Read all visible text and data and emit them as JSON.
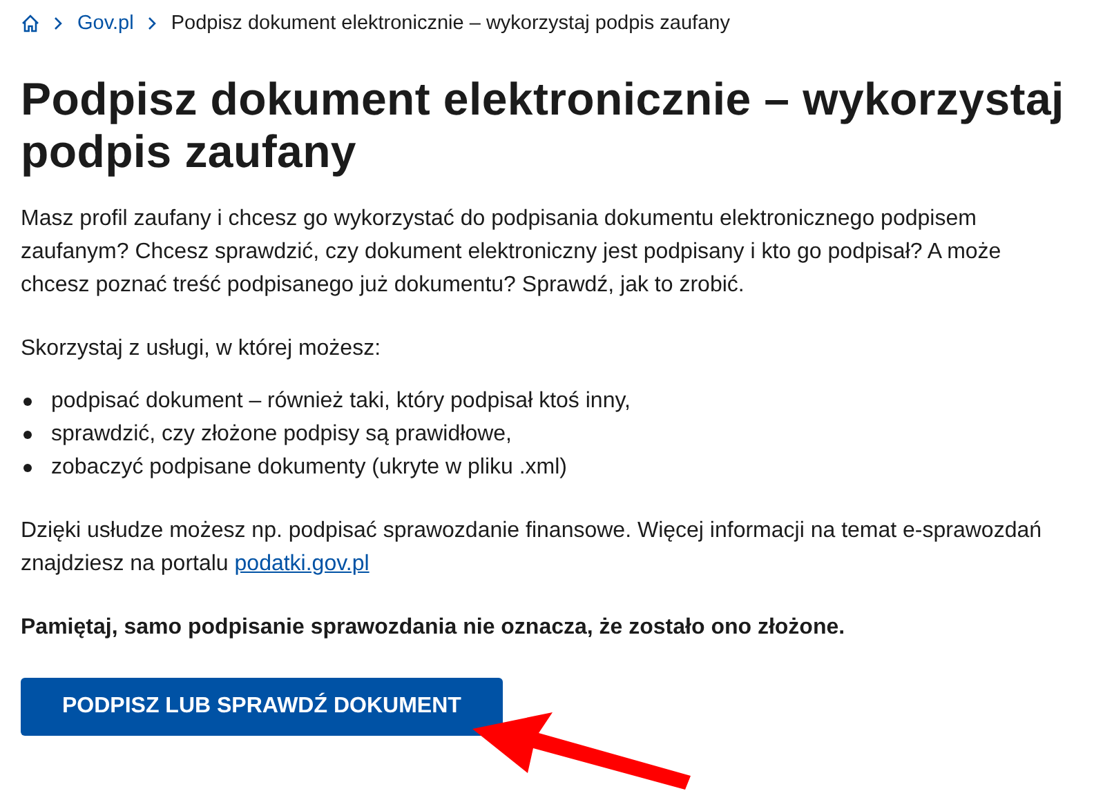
{
  "breadcrumb": [
    {
      "label": "Gov.pl",
      "kind": "link"
    },
    {
      "label": "Podpisz dokument elektronicznie – wykorzystaj podpis zaufany",
      "kind": "current"
    }
  ],
  "title": "Podpisz dokument elektronicznie – wykorzystaj podpis zaufany",
  "intro": "Masz profil zaufany i chcesz go wykorzystać do podpisania dokumentu elektronicznego podpisem zaufanym? Chcesz sprawdzić, czy dokument elektroniczny jest podpisany i kto go podpisał? A może chcesz poznać treść podpisanego już dokumentu? Sprawdź, jak to zrobić.",
  "list_intro": "Skorzystaj z usługi, w której możesz:",
  "list_items": [
    "podpisać dokument – również taki, który podpisał ktoś inny,",
    "sprawdzić, czy złożone podpisy są prawidłowe,",
    "zobaczyć podpisane dokumenty (ukryte w pliku .xml)"
  ],
  "info": {
    "text": "Dzięki usłudze możesz np. podpisać sprawozdanie finansowe. Więcej informacji na temat e-sprawozdań znajdziesz na portalu ",
    "link": "podatki.gov.pl"
  },
  "notice": "Pamiętaj, samo podpisanie sprawozdania nie oznacza, że zostało ono złożone.",
  "button": "PODPISZ LUB SPRAWDŹ DOKUMENT",
  "annotation": {
    "kind": "arrow"
  }
}
